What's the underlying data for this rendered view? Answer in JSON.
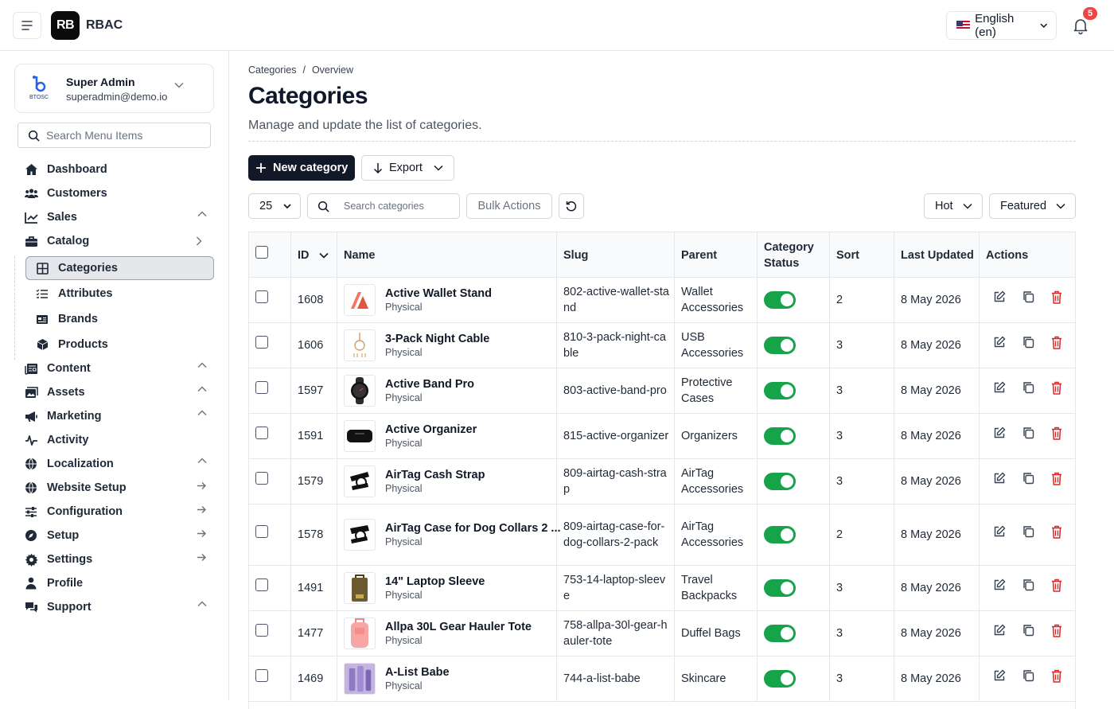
{
  "topbar": {
    "logo_text": "RB",
    "app_name": "RBAC",
    "language": "English (en)",
    "notification_count": "5"
  },
  "user": {
    "logo_caption": "BTOSC",
    "name": "Super Admin",
    "email": "superadmin@demo.io"
  },
  "sidebar": {
    "search_placeholder": "Search Menu Items",
    "items": [
      {
        "label": "Dashboard",
        "icon": "home-icon"
      },
      {
        "label": "Customers",
        "icon": "users-icon"
      },
      {
        "label": "Sales",
        "icon": "chart-line-icon",
        "right": "chevron-up-icon"
      },
      {
        "label": "Catalog",
        "icon": "briefcase-icon",
        "right": "chevron-right-icon"
      },
      {
        "label": "Content",
        "icon": "newspaper-icon",
        "right": "chevron-up-icon"
      },
      {
        "label": "Assets",
        "icon": "images-icon",
        "right": "chevron-up-icon"
      },
      {
        "label": "Marketing",
        "icon": "megaphone-icon",
        "right": "chevron-up-icon"
      },
      {
        "label": "Activity",
        "icon": "activity-icon"
      },
      {
        "label": "Localization",
        "icon": "globe-icon",
        "right": "chevron-up-icon"
      },
      {
        "label": "Website Setup",
        "icon": "globe-icon",
        "right": "arrow-right-icon"
      },
      {
        "label": "Configuration",
        "icon": "sliders-icon",
        "right": "arrow-right-icon"
      },
      {
        "label": "Setup",
        "icon": "compass-icon",
        "right": "arrow-right-icon"
      },
      {
        "label": "Settings",
        "icon": "gear-icon",
        "right": "arrow-right-icon"
      },
      {
        "label": "Profile",
        "icon": "user-icon"
      },
      {
        "label": "Support",
        "icon": "chat-icon",
        "right": "chevron-up-icon"
      }
    ],
    "catalog_sub": [
      {
        "label": "Categories",
        "icon": "grid-icon",
        "active": true
      },
      {
        "label": "Attributes",
        "icon": "list-icon"
      },
      {
        "label": "Brands",
        "icon": "id-card-icon"
      },
      {
        "label": "Products",
        "icon": "box-icon"
      }
    ]
  },
  "page": {
    "breadcrumb": [
      "Categories",
      "Overview"
    ],
    "breadcrumb_sep": "/",
    "title": "Categories",
    "description": "Manage and update the list of categories."
  },
  "toolbar": {
    "new_label": "New category",
    "export_label": "Export",
    "per_page": "25",
    "search_placeholder": "Search categories",
    "bulk_label": "Bulk Actions",
    "filter_hot": "Hot",
    "filter_featured": "Featured"
  },
  "table": {
    "columns": [
      "ID",
      "Name",
      "Slug",
      "Parent",
      "Category Status",
      "Sort",
      "Last Updated",
      "Actions"
    ],
    "rows": [
      {
        "id": "1608",
        "name": "Active Wallet Stand",
        "type": "Physical",
        "slug": "802-active-wallet-stand",
        "parent": "Wallet Accessories",
        "status": true,
        "sort": "2",
        "updated": "8 May 2026",
        "thumb": "wallet-stand-image"
      },
      {
        "id": "1606",
        "name": "3-Pack Night Cable",
        "type": "Physical",
        "slug": "810-3-pack-night-cable",
        "parent": "USB Accessories",
        "status": true,
        "sort": "3",
        "updated": "8 May 2026",
        "thumb": "cable-image"
      },
      {
        "id": "1597",
        "name": "Active Band Pro",
        "type": "Physical",
        "slug": "803-active-band-pro",
        "parent": "Protective Cases",
        "status": true,
        "sort": "3",
        "updated": "8 May 2026",
        "thumb": "watch-image"
      },
      {
        "id": "1591",
        "name": "Active Organizer",
        "type": "Physical",
        "slug": "815-active-organizer",
        "parent": "Organizers",
        "status": true,
        "sort": "3",
        "updated": "8 May 2026",
        "thumb": "organizer-image"
      },
      {
        "id": "1579",
        "name": "AirTag Cash Strap",
        "type": "Physical",
        "slug": "809-airtag-cash-strap",
        "parent": "AirTag Accessories",
        "status": true,
        "sort": "3",
        "updated": "8 May 2026",
        "thumb": "airtag-strap-image"
      },
      {
        "id": "1578",
        "name": "AirTag Case for Dog Collars 2 ...",
        "type": "Physical",
        "slug": "809-airtag-case-for-dog-collars-2-pack",
        "parent": "AirTag Accessories",
        "status": true,
        "sort": "2",
        "updated": "8 May 2026",
        "thumb": "airtag-case-image"
      },
      {
        "id": "1491",
        "name": "14\" Laptop Sleeve",
        "type": "Physical",
        "slug": "753-14-laptop-sleeve",
        "parent": "Travel Backpacks",
        "status": true,
        "sort": "3",
        "updated": "8 May 2026",
        "thumb": "laptop-sleeve-image"
      },
      {
        "id": "1477",
        "name": "Allpa 30L Gear Hauler Tote",
        "type": "Physical",
        "slug": "758-allpa-30l-gear-hauler-tote",
        "parent": "Duffel Bags",
        "status": true,
        "sort": "3",
        "updated": "8 May 2026",
        "thumb": "tote-image"
      },
      {
        "id": "1469",
        "name": "A-List Babe",
        "type": "Physical",
        "slug": "744-a-list-babe",
        "parent": "Skincare",
        "status": true,
        "sort": "3",
        "updated": "8 May 2026",
        "thumb": "skincare-image"
      }
    ]
  },
  "colors": {
    "primary": "#111827",
    "toggle_on": "#16a34a",
    "delete": "#dc2626",
    "badge": "#ef4444"
  }
}
